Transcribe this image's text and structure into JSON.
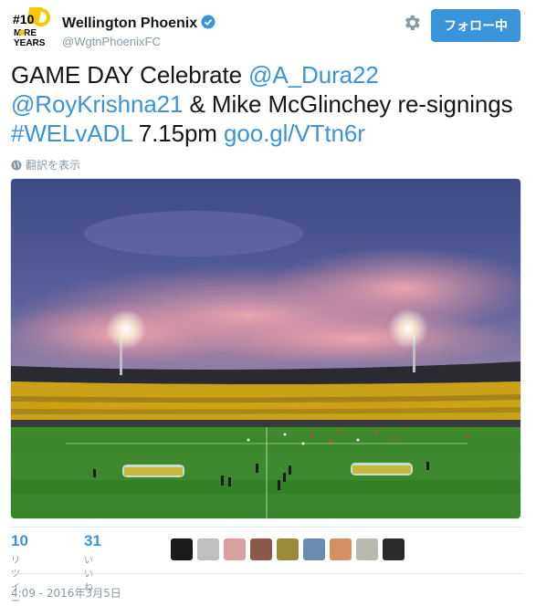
{
  "user": {
    "name": "Wellington Phoenix",
    "screen_name": "@WgtnPhoenixFC",
    "avatar_text_top": "#10",
    "avatar_text_bottom": "MORE YEARS",
    "verified": true
  },
  "actions": {
    "follow_label": "フォロー中",
    "settings_icon": "gear-icon"
  },
  "tweet": {
    "seg1": "GAME DAY Celebrate ",
    "mention1": "@A_Dura22",
    "mention2": "@RoyKrishna21",
    "seg2": " & Mike McGlinchey re-signings ",
    "hashtag": "#WELvADL",
    "seg3": " 7.15pm ",
    "url": "goo.gl/VTtn6r"
  },
  "translate": {
    "label": "翻訳を表示",
    "icon": "globe-icon"
  },
  "stats": {
    "retweets_count": "10",
    "retweets_label": "リツイート",
    "likes_count": "31",
    "likes_label": "いいね"
  },
  "likers": [
    {
      "name": "liker-avatar-1",
      "color": "#1a1a1a"
    },
    {
      "name": "liker-avatar-2",
      "color": "#bfbfbf"
    },
    {
      "name": "liker-avatar-3",
      "color": "#d8a0a0"
    },
    {
      "name": "liker-avatar-4",
      "color": "#8a5a4a"
    },
    {
      "name": "liker-avatar-5",
      "color": "#9a8a3a"
    },
    {
      "name": "liker-avatar-6",
      "color": "#6a8ab0"
    },
    {
      "name": "liker-avatar-7",
      "color": "#d49060"
    },
    {
      "name": "liker-avatar-8",
      "color": "#b8b8b0"
    },
    {
      "name": "liker-avatar-9",
      "color": "#2a2a2a"
    }
  ],
  "timestamp": "4:09 - 2016年3月5日",
  "colors": {
    "link": "#3b94d9",
    "muted": "#8899a6",
    "brand_yellow": "#f5c800"
  }
}
